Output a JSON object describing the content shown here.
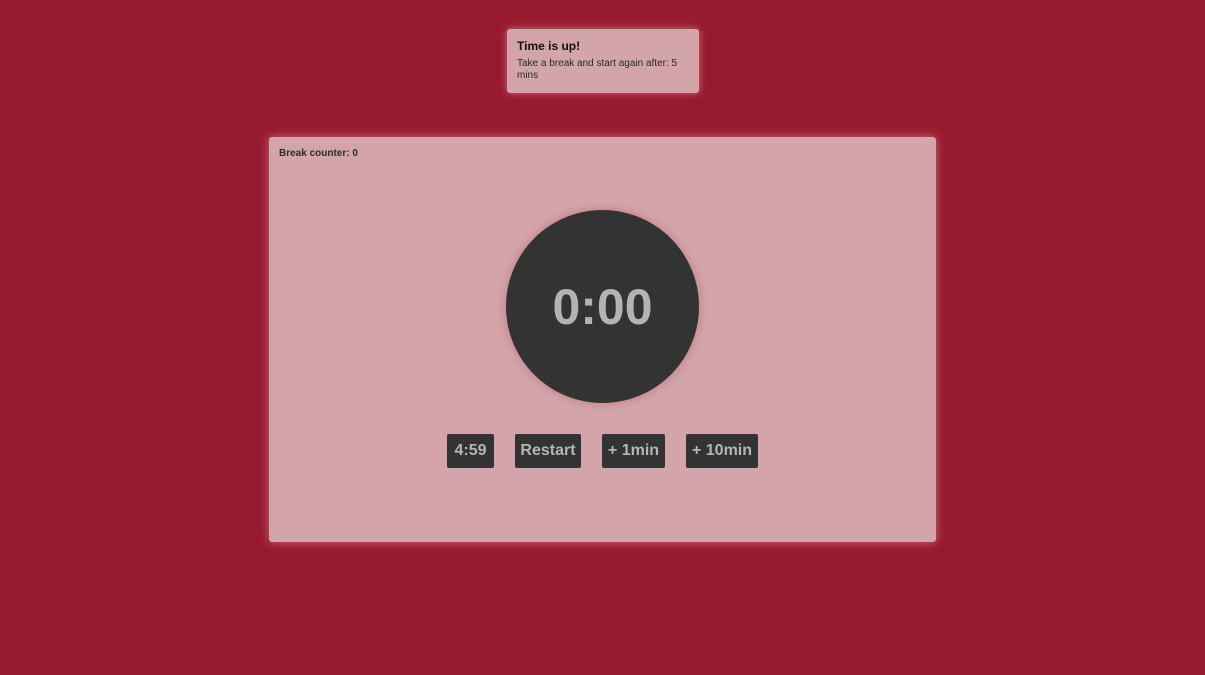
{
  "colors": {
    "background": "#971a2f",
    "panel": "#d3a5ab",
    "dark": "#333333",
    "light_text": "#b3b3b3"
  },
  "notification": {
    "title": "Time is up!",
    "message": "Take a break and start again after: 5 mins"
  },
  "timer": {
    "break_counter": "Break counter: 0",
    "time": "0:00"
  },
  "controls": {
    "pause_label": "4:59",
    "restart_label": "Restart",
    "add_one_label": "+ 1min",
    "add_ten_label": "+ 10min"
  }
}
